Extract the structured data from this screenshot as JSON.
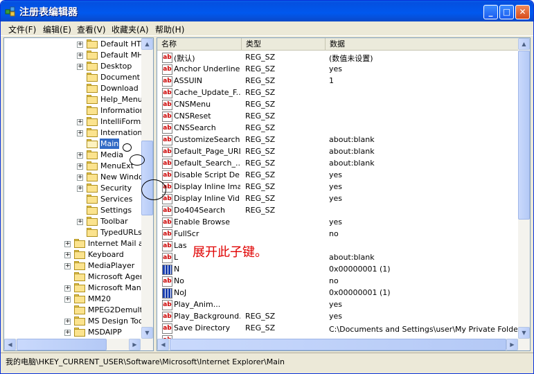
{
  "window": {
    "title": "注册表编辑器",
    "min_glyph": "_",
    "max_glyph": "□",
    "close_glyph": "✕"
  },
  "menu": [
    "文件(F)",
    "编辑(E)",
    "查看(V)",
    "收藏夹(A)",
    "帮助(H)"
  ],
  "tree": [
    {
      "label": "Default HTM",
      "level": 3,
      "expander": "+"
    },
    {
      "label": "Default MHT",
      "level": 3,
      "expander": "+"
    },
    {
      "label": "Desktop",
      "level": 3,
      "expander": "+"
    },
    {
      "label": "Document W",
      "level": 3,
      "expander": ""
    },
    {
      "label": "Download",
      "level": 3,
      "expander": ""
    },
    {
      "label": "Help_Menu_",
      "level": 3,
      "expander": ""
    },
    {
      "label": "Information",
      "level": 3,
      "expander": ""
    },
    {
      "label": "IntelliForms",
      "level": 3,
      "expander": "+"
    },
    {
      "label": "International",
      "level": 3,
      "expander": "+"
    },
    {
      "label": "Main",
      "level": 3,
      "expander": "",
      "selected": true
    },
    {
      "label": "Media",
      "level": 3,
      "expander": "+"
    },
    {
      "label": "MenuExt",
      "level": 3,
      "expander": "+"
    },
    {
      "label": "New Window",
      "level": 3,
      "expander": "+"
    },
    {
      "label": "Security",
      "level": 3,
      "expander": "+"
    },
    {
      "label": "Services",
      "level": 3,
      "expander": ""
    },
    {
      "label": "Settings",
      "level": 3,
      "expander": ""
    },
    {
      "label": "Toolbar",
      "level": 3,
      "expander": "+"
    },
    {
      "label": "TypedURLs",
      "level": 3,
      "expander": ""
    },
    {
      "label": "Internet Mail an",
      "level": 2,
      "expander": "+"
    },
    {
      "label": "Keyboard",
      "level": 2,
      "expander": "+"
    },
    {
      "label": "MediaPlayer",
      "level": 2,
      "expander": "+"
    },
    {
      "label": "Microsoft Agent",
      "level": 2,
      "expander": ""
    },
    {
      "label": "Microsoft Manag",
      "level": 2,
      "expander": "+"
    },
    {
      "label": "MM20",
      "level": 2,
      "expander": "+"
    },
    {
      "label": "MPEG2Demultipl",
      "level": 2,
      "expander": ""
    },
    {
      "label": "MS Design Tools",
      "level": 2,
      "expander": "+"
    },
    {
      "label": "MSDAIPP",
      "level": 2,
      "expander": "+"
    }
  ],
  "columns": {
    "name": "名称",
    "type": "类型",
    "data": "数据"
  },
  "values": [
    {
      "icon": "ab",
      "name": "(默认)",
      "type": "REG_SZ",
      "data": "(数值未设置)"
    },
    {
      "icon": "ab",
      "name": "Anchor Underline",
      "type": "REG_SZ",
      "data": "yes"
    },
    {
      "icon": "ab",
      "name": "ASSUIN",
      "type": "REG_SZ",
      "data": "1"
    },
    {
      "icon": "ab",
      "name": "Cache_Update_F...",
      "type": "REG_SZ",
      "data": ""
    },
    {
      "icon": "ab",
      "name": "CNSMenu",
      "type": "REG_SZ",
      "data": ""
    },
    {
      "icon": "ab",
      "name": "CNSReset",
      "type": "REG_SZ",
      "data": ""
    },
    {
      "icon": "ab",
      "name": "CNSSearch",
      "type": "REG_SZ",
      "data": ""
    },
    {
      "icon": "ab",
      "name": "CustomizeSearch",
      "type": "REG_SZ",
      "data": "about:blank"
    },
    {
      "icon": "ab",
      "name": "Default_Page_URL",
      "type": "REG_SZ",
      "data": "about:blank"
    },
    {
      "icon": "ab",
      "name": "Default_Search_...",
      "type": "REG_SZ",
      "data": "about:blank"
    },
    {
      "icon": "ab",
      "name": "Disable Script De...",
      "type": "REG_SZ",
      "data": "yes"
    },
    {
      "icon": "ab",
      "name": "Display Inline Ima...",
      "type": "REG_SZ",
      "data": "yes"
    },
    {
      "icon": "ab",
      "name": "Display Inline Vid...",
      "type": "REG_SZ",
      "data": "yes"
    },
    {
      "icon": "ab",
      "name": "Do404Search",
      "type": "REG_SZ",
      "data": ""
    },
    {
      "icon": "ab",
      "name": "Enable Browse",
      "type": "",
      "data": "yes"
    },
    {
      "icon": "ab",
      "name": "FullScr",
      "type": "",
      "data": "no"
    },
    {
      "icon": "ab",
      "name": "Las",
      "type": "",
      "data": ""
    },
    {
      "icon": "ab",
      "name": "L",
      "type": "",
      "data": "about:blank"
    },
    {
      "icon": "bin",
      "name": "N",
      "type": "",
      "data": "0x00000001 (1)"
    },
    {
      "icon": "ab",
      "name": "No",
      "type": "",
      "data": "no"
    },
    {
      "icon": "bin",
      "name": "NoJ",
      "type": "",
      "data": "0x00000001 (1)"
    },
    {
      "icon": "ab",
      "name": "Play_Anim...",
      "type": "",
      "data": "yes"
    },
    {
      "icon": "ab",
      "name": "Play_Background...",
      "type": "REG_SZ",
      "data": "yes"
    },
    {
      "icon": "ab",
      "name": "Save Directory",
      "type": "REG_SZ",
      "data": "C:\\Documents and Settings\\user\\My Private Folder\\新..."
    },
    {
      "icon": "ab",
      "name": "",
      "type": "",
      "data": ""
    }
  ],
  "annotation": "展开此子键。",
  "status": "我的电脑\\HKEY_CURRENT_USER\\Software\\Microsoft\\Internet Explorer\\Main",
  "scroll_arrows": {
    "up": "▲",
    "down": "▼",
    "left": "◀",
    "right": "▶"
  }
}
